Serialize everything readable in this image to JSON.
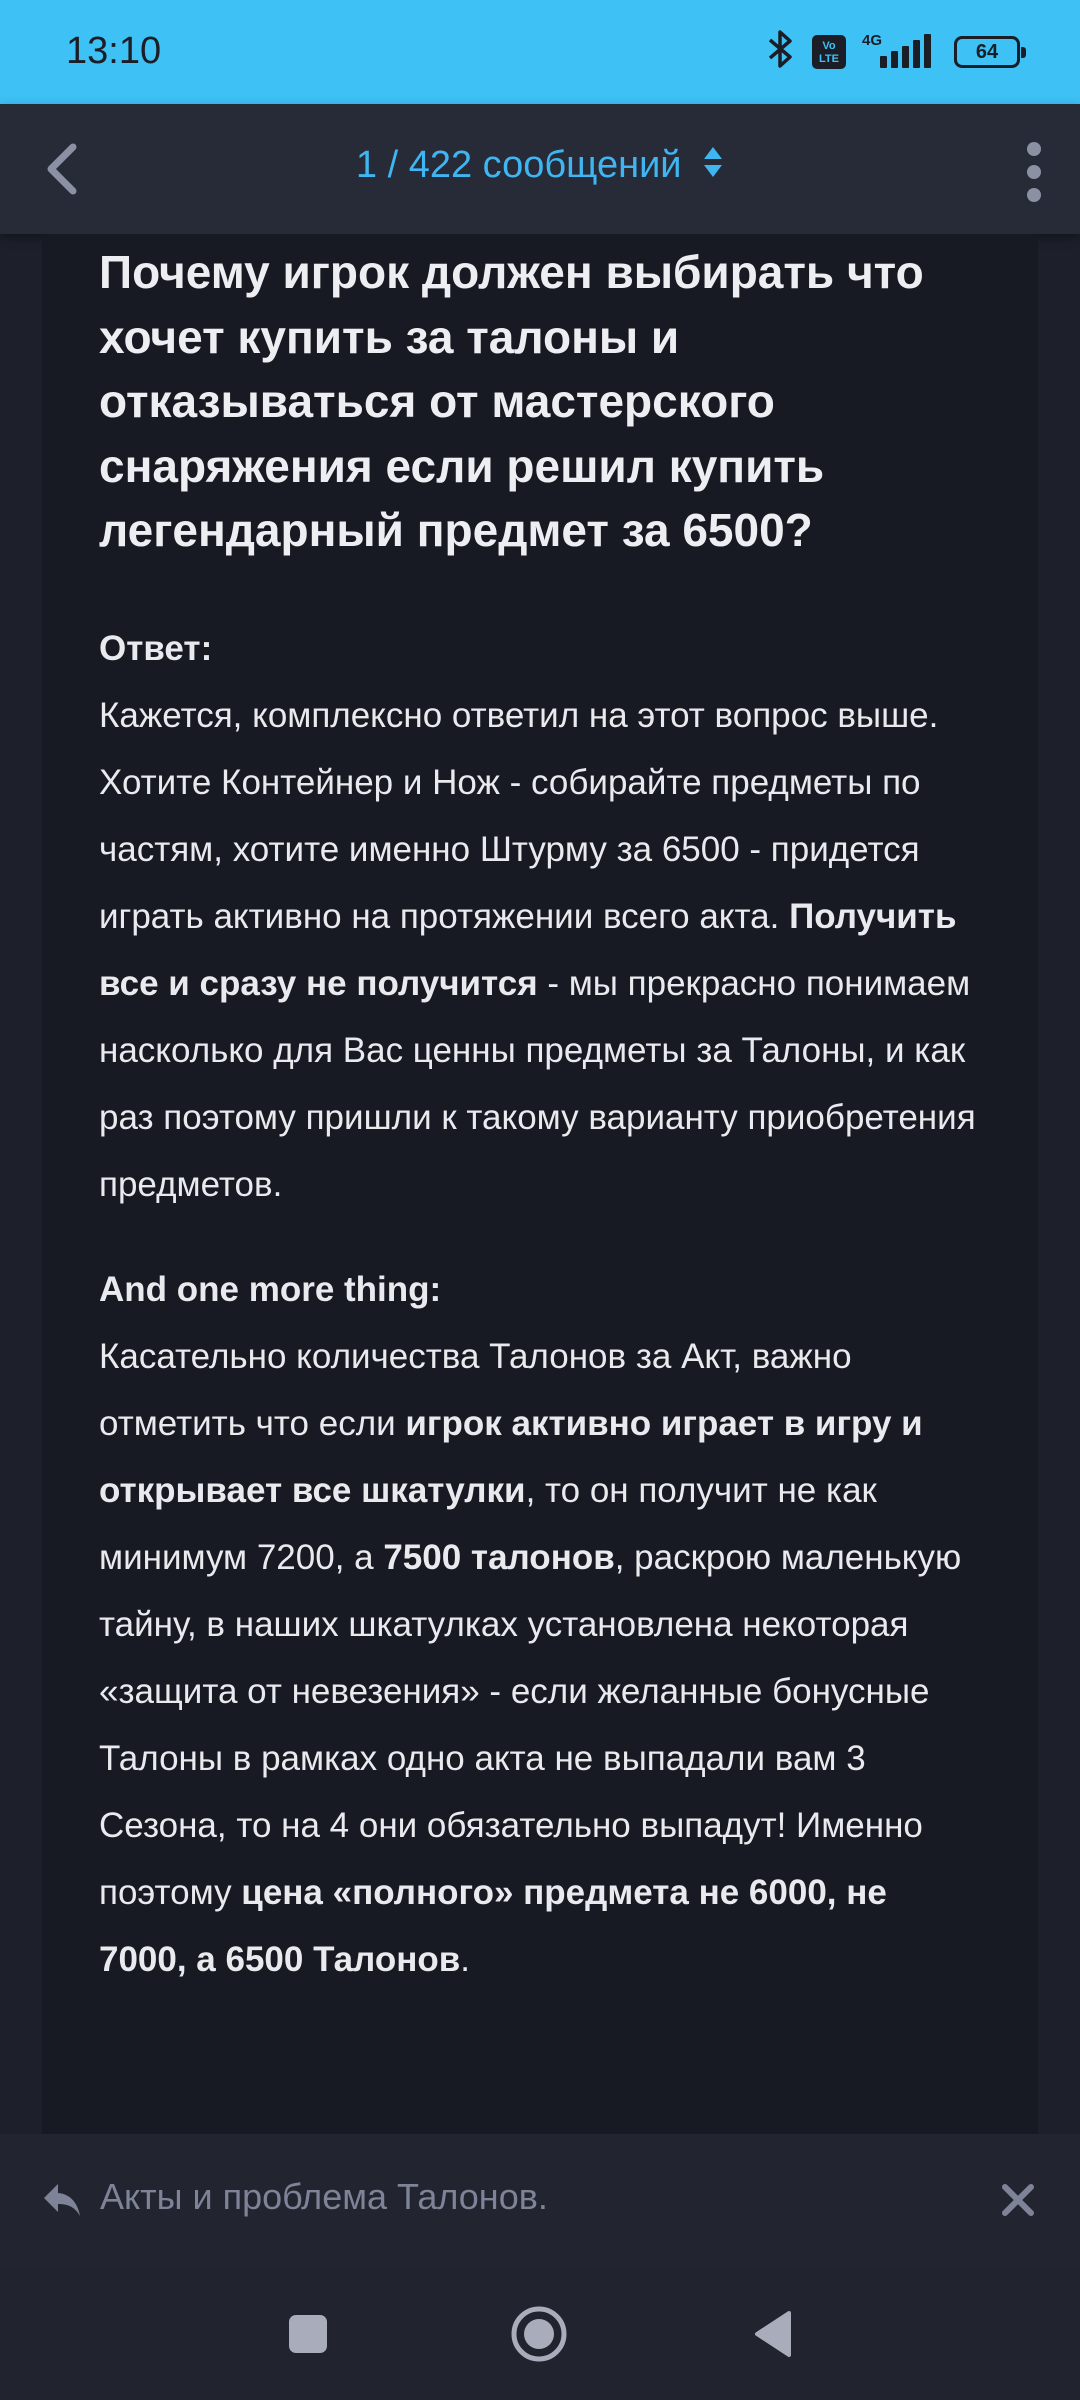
{
  "status_bar": {
    "time": "13:10",
    "icons": [
      "bluetooth-icon",
      "volte-icon",
      "signal-4g-icon",
      "battery-icon"
    ],
    "volte_label": "Vo LTE",
    "network": "4G",
    "battery": "64"
  },
  "header": {
    "title": "1 / 422 сообщений",
    "icons": [
      "back-arrow-icon",
      "sort-updown-icon",
      "more-vert-icon"
    ]
  },
  "message": {
    "question": "Почему игрок должен выбирать что хочет купить за талоны и отказываться от мастерского снаряжения если решил купить легендарный предмет за 6500?",
    "answer_label": "Ответ:",
    "answer_part1": "Кажется, комплексно ответил на этот вопрос выше. Хотите Контейнер и Нож - собирайте предметы по частям, хотите именно Штурму за 6500 - придется играть активно на протяжении всего акта. ",
    "answer_bold": "Получить все и сразу не получится",
    "answer_part2": " - мы прекрасно понимаем насколько для Вас ценны предметы за Талоны, и как раз поэтому пришли к такому варианту приобретения предметов.",
    "extra_label": "And one more thing:",
    "extra_part1": "Касательно количества Талонов за Акт, важно отметить что если ",
    "extra_bold1": "игрок активно играет в игру и открывает все шкатулки",
    "extra_part2": ", то он получит не как минимум 7200, а ",
    "extra_bold2": "7500 талонов",
    "extra_part3": ", раскрою маленькую тайну, в наших шкатулках установлена некоторая «защита от невезения» - если желанные бонусные Талоны в рамках одно акта не выпадали вам 3 Сезона, то на 4 они обязательно выпадут! Именно поэтому ",
    "extra_bold3": "цена «полного» предмета не 6000, не 7000, а 6500 Талонов",
    "extra_part4": "."
  },
  "reply_bar": {
    "text": "Акты и проблема Талонов.",
    "icons": [
      "reply-icon",
      "close-icon"
    ]
  },
  "nav_bar": {
    "icons": [
      "recents-square-icon",
      "home-circle-icon",
      "back-triangle-icon"
    ]
  },
  "colors": {
    "status_bar": "#3ec1f5",
    "app_bar": "#272a37",
    "card": "#171a23",
    "accent": "#3fb6f2",
    "text": "#e9eaee",
    "muted": "#7e8398"
  }
}
